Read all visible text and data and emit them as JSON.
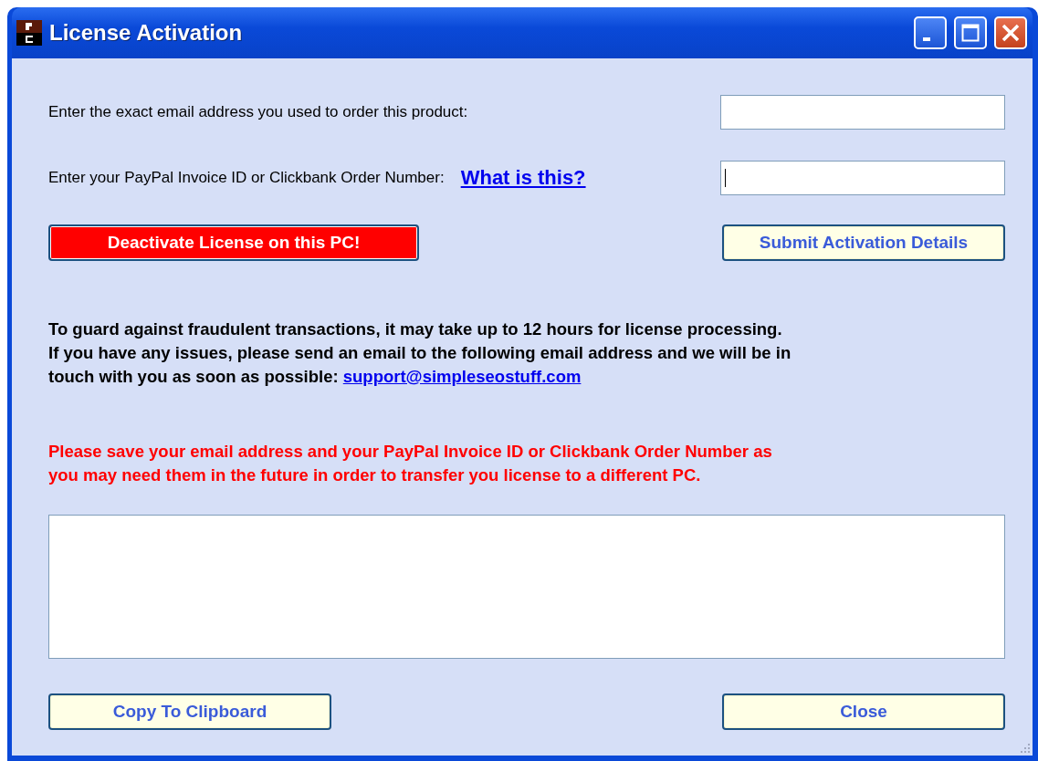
{
  "window": {
    "title": "License Activation",
    "controls": [
      {
        "kind": "minimize"
      },
      {
        "kind": "maximize"
      },
      {
        "kind": "close"
      }
    ]
  },
  "fields": [
    {
      "label": "Enter the exact email address you used to order this product:",
      "focused": false
    },
    {
      "label": "Enter your PayPal Invoice ID or Clickbank Order Number:",
      "link": "What is this?",
      "focused": true
    }
  ],
  "action_buttons": [
    {
      "label": "Deactivate License on this PC!",
      "kind": "danger"
    },
    {
      "label": "Submit Activation Details",
      "kind": "normal"
    }
  ],
  "info": {
    "text": "To guard against fraudulent transactions, it may take up to 12 hours for license processing.\nIf you have any issues, please send an email to the following email address and we will be in\ntouch with you as soon as possible: ",
    "link": "support@simpleseostuff.com"
  },
  "warning": "Please save your email address and your PayPal Invoice ID or Clickbank Order Number as\nyou may need them in the future in order to transfer you license to a different PC.",
  "bottom_buttons": [
    {
      "label": "Copy To Clipboard"
    },
    {
      "label": "Close"
    }
  ]
}
